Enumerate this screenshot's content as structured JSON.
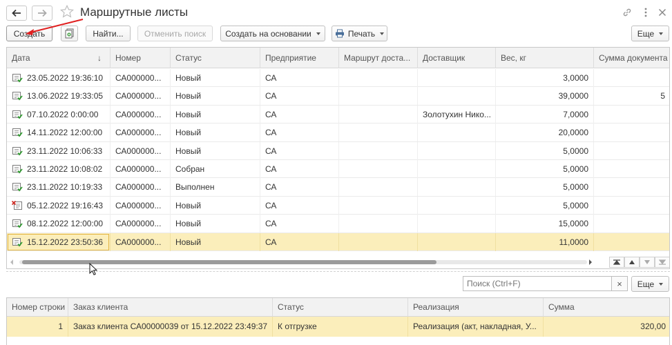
{
  "window": {
    "title": "Маршрутные листы",
    "back_icon": "arrow-left-icon",
    "forward_icon": "arrow-right-icon",
    "favorite_icon": "star-icon",
    "link_icon": "link-icon",
    "menu_icon": "kebab-menu-icon",
    "close_icon": "close-icon"
  },
  "toolbar": {
    "create": "Создать",
    "copy_icon": "copy-document-icon",
    "find": "Найти...",
    "cancel_search": "Отменить поиск",
    "create_based_on": "Создать на основании",
    "print": "Печать",
    "more": "Еще"
  },
  "main_table": {
    "columns": [
      "Дата",
      "Номер",
      "Статус",
      "Предприятие",
      "Маршрут доста...",
      "Доставщик",
      "Вес, кг",
      "Сумма документа"
    ],
    "sort_indicator": "↓",
    "rows": [
      {
        "date": "23.05.2022 19:36:10",
        "number": "СА000000...",
        "status": "Новый",
        "company": "СА",
        "route": "",
        "courier": "",
        "weight": "3,0000",
        "sum": "",
        "icon": "posted-doc-icon"
      },
      {
        "date": "13.06.2022 19:33:05",
        "number": "СА000000...",
        "status": "Новый",
        "company": "СА",
        "route": "",
        "courier": "",
        "weight": "39,0000",
        "sum": "5",
        "icon": "posted-doc-icon"
      },
      {
        "date": "07.10.2022 0:00:00",
        "number": "СА000000...",
        "status": "Новый",
        "company": "СА",
        "route": "",
        "courier": "Золотухин Нико...",
        "weight": "7,0000",
        "sum": "",
        "icon": "posted-doc-icon"
      },
      {
        "date": "14.11.2022 12:00:00",
        "number": "СА000000...",
        "status": "Новый",
        "company": "СА",
        "route": "",
        "courier": "",
        "weight": "20,0000",
        "sum": "",
        "icon": "posted-doc-icon"
      },
      {
        "date": "23.11.2022 10:06:33",
        "number": "СА000000...",
        "status": "Новый",
        "company": "СА",
        "route": "",
        "courier": "",
        "weight": "5,0000",
        "sum": "",
        "icon": "posted-doc-icon"
      },
      {
        "date": "23.11.2022 10:08:02",
        "number": "СА000000...",
        "status": "Собран",
        "company": "СА",
        "route": "",
        "courier": "",
        "weight": "5,0000",
        "sum": "",
        "icon": "posted-doc-icon"
      },
      {
        "date": "23.11.2022 10:19:33",
        "number": "СА000000...",
        "status": "Выполнен",
        "company": "СА",
        "route": "",
        "courier": "",
        "weight": "5,0000",
        "sum": "",
        "icon": "posted-doc-icon"
      },
      {
        "date": "05.12.2022 19:16:43",
        "number": "СА000000...",
        "status": "Новый",
        "company": "СА",
        "route": "",
        "courier": "",
        "weight": "5,0000",
        "sum": "",
        "icon": "deleted-doc-icon"
      },
      {
        "date": "08.12.2022 12:00:00",
        "number": "СА000000...",
        "status": "Новый",
        "company": "СА",
        "route": "",
        "courier": "",
        "weight": "15,0000",
        "sum": "",
        "icon": "posted-doc-icon"
      },
      {
        "date": "15.12.2022 23:50:36",
        "number": "СА000000...",
        "status": "Новый",
        "company": "СА",
        "route": "",
        "courier": "",
        "weight": "11,0000",
        "sum": "",
        "icon": "posted-doc-icon",
        "selected": true
      }
    ],
    "scroll_buttons": [
      "scroll-first-icon",
      "scroll-up-icon",
      "scroll-down-icon",
      "scroll-last-icon"
    ]
  },
  "search": {
    "placeholder": "Поиск (Ctrl+F)",
    "clear": "×",
    "more": "Еще"
  },
  "sub_table": {
    "columns": [
      "Номер строки",
      "Заказ клиента",
      "Статус",
      "Реализация",
      "Сумма"
    ],
    "rows": [
      {
        "line": "1",
        "order": "Заказ клиента СА00000039 от 15.12.2022 23:49:37",
        "status": "К отгрузке",
        "sale": "Реализация (акт, накладная, У...",
        "sum": "320,00"
      }
    ]
  },
  "colors": {
    "selection": "#fbeebb",
    "focus_border": "#e3b544",
    "annotation_arrow": "#e02020"
  }
}
